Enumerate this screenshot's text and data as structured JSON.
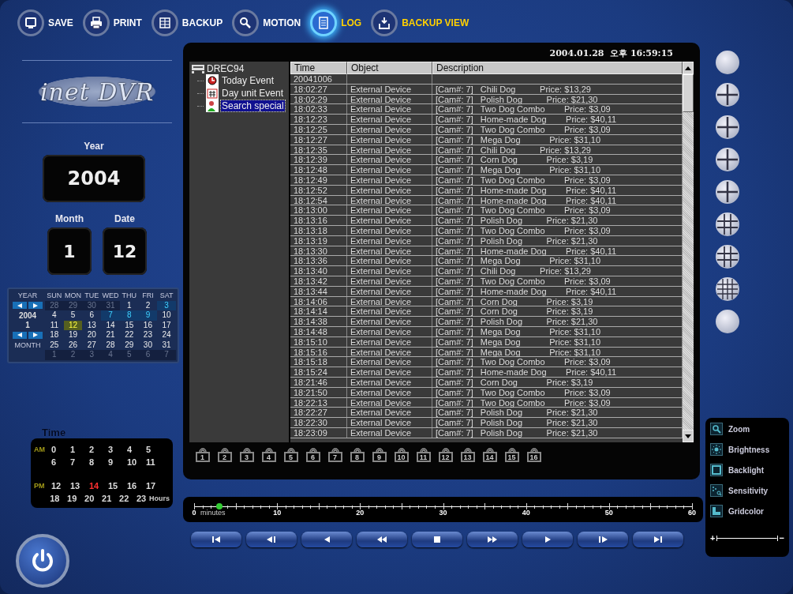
{
  "toolbar": [
    {
      "label": "SAVE",
      "kind": "save",
      "selected": false,
      "highlighted": false
    },
    {
      "label": "PRINT",
      "kind": "print",
      "selected": false,
      "highlighted": false
    },
    {
      "label": "BACKUP",
      "kind": "backup",
      "selected": false,
      "highlighted": false
    },
    {
      "label": "MOTION",
      "kind": "motion",
      "selected": false,
      "highlighted": false
    },
    {
      "label": "LOG",
      "kind": "log",
      "selected": true,
      "highlighted": true
    },
    {
      "label": "BACKUP VIEW",
      "kind": "backup_view",
      "selected": false,
      "highlighted": true
    }
  ],
  "logo": "inet DVR",
  "date_fields": {
    "year_label": "Year",
    "year": "2004",
    "month_label": "Month",
    "month": "1",
    "date_label": "Date",
    "date": "12"
  },
  "calendar": {
    "year_label": "YEAR",
    "year": "2004",
    "month": "1",
    "month_label": "MONTH",
    "weekdays": [
      "SUN",
      "MON",
      "TUE",
      "WED",
      "THU",
      "FRI",
      "SAT"
    ],
    "weeks": [
      [
        {
          "day": "28",
          "current": false,
          "event": false,
          "selected": false
        },
        {
          "day": "29",
          "current": false,
          "event": false,
          "selected": false
        },
        {
          "day": "30",
          "current": false,
          "event": false,
          "selected": false
        },
        {
          "day": "31",
          "current": false,
          "event": false,
          "selected": false
        },
        {
          "day": "1",
          "current": true,
          "event": false,
          "selected": false
        },
        {
          "day": "2",
          "current": true,
          "event": false,
          "selected": false
        },
        {
          "day": "3",
          "current": true,
          "event": true,
          "selected": false
        }
      ],
      [
        {
          "day": "4",
          "current": true,
          "event": false,
          "selected": false
        },
        {
          "day": "5",
          "current": true,
          "event": false,
          "selected": false
        },
        {
          "day": "6",
          "current": true,
          "event": false,
          "selected": false
        },
        {
          "day": "7",
          "current": true,
          "event": true,
          "selected": false
        },
        {
          "day": "8",
          "current": true,
          "event": true,
          "selected": false
        },
        {
          "day": "9",
          "current": true,
          "event": true,
          "selected": false
        },
        {
          "day": "10",
          "current": true,
          "event": false,
          "selected": false
        }
      ],
      [
        {
          "day": "11",
          "current": true,
          "event": false,
          "selected": false
        },
        {
          "day": "12",
          "current": true,
          "event": false,
          "selected": true
        },
        {
          "day": "13",
          "current": true,
          "event": false,
          "selected": false
        },
        {
          "day": "14",
          "current": true,
          "event": false,
          "selected": false
        },
        {
          "day": "15",
          "current": true,
          "event": false,
          "selected": false
        },
        {
          "day": "16",
          "current": true,
          "event": false,
          "selected": false
        },
        {
          "day": "17",
          "current": true,
          "event": false,
          "selected": false
        }
      ],
      [
        {
          "day": "18",
          "current": true,
          "event": false,
          "selected": false
        },
        {
          "day": "19",
          "current": true,
          "event": false,
          "selected": false
        },
        {
          "day": "20",
          "current": true,
          "event": false,
          "selected": false
        },
        {
          "day": "21",
          "current": true,
          "event": false,
          "selected": false
        },
        {
          "day": "22",
          "current": true,
          "event": false,
          "selected": false
        },
        {
          "day": "23",
          "current": true,
          "event": false,
          "selected": false
        },
        {
          "day": "24",
          "current": true,
          "event": false,
          "selected": false
        }
      ],
      [
        {
          "day": "25",
          "current": true,
          "event": false,
          "selected": false
        },
        {
          "day": "26",
          "current": true,
          "event": false,
          "selected": false
        },
        {
          "day": "27",
          "current": true,
          "event": false,
          "selected": false
        },
        {
          "day": "28",
          "current": true,
          "event": false,
          "selected": false
        },
        {
          "day": "29",
          "current": true,
          "event": false,
          "selected": false
        },
        {
          "day": "30",
          "current": true,
          "event": false,
          "selected": false
        },
        {
          "day": "31",
          "current": true,
          "event": false,
          "selected": false
        }
      ],
      [
        {
          "day": "1",
          "current": false,
          "event": false,
          "selected": false
        },
        {
          "day": "2",
          "current": false,
          "event": false,
          "selected": false
        },
        {
          "day": "3",
          "current": false,
          "event": false,
          "selected": false
        },
        {
          "day": "4",
          "current": false,
          "event": false,
          "selected": false
        },
        {
          "day": "5",
          "current": false,
          "event": false,
          "selected": false
        },
        {
          "day": "6",
          "current": false,
          "event": false,
          "selected": false
        },
        {
          "day": "7",
          "current": false,
          "event": false,
          "selected": false
        }
      ]
    ]
  },
  "time": {
    "title": "Time",
    "unit": "Hours",
    "periods": [
      {
        "label": "AM",
        "rows": [
          [
            {
              "hour": "0",
              "selected": false
            },
            {
              "hour": "1",
              "selected": false
            },
            {
              "hour": "2",
              "selected": false
            },
            {
              "hour": "3",
              "selected": false
            },
            {
              "hour": "4",
              "selected": false
            },
            {
              "hour": "5",
              "selected": false
            }
          ],
          [
            {
              "hour": "6",
              "selected": false
            },
            {
              "hour": "7",
              "selected": false
            },
            {
              "hour": "8",
              "selected": false
            },
            {
              "hour": "9",
              "selected": false
            },
            {
              "hour": "10",
              "selected": false
            },
            {
              "hour": "11",
              "selected": false
            }
          ]
        ]
      },
      {
        "label": "PM",
        "rows": [
          [
            {
              "hour": "12",
              "selected": false
            },
            {
              "hour": "13",
              "selected": false
            },
            {
              "hour": "14",
              "selected": true
            },
            {
              "hour": "15",
              "selected": false
            },
            {
              "hour": "16",
              "selected": false
            },
            {
              "hour": "17",
              "selected": false
            }
          ],
          [
            {
              "hour": "18",
              "selected": false
            },
            {
              "hour": "19",
              "selected": false
            },
            {
              "hour": "20",
              "selected": false
            },
            {
              "hour": "21",
              "selected": false
            },
            {
              "hour": "22",
              "selected": false
            },
            {
              "hour": "23",
              "selected": false
            }
          ]
        ]
      }
    ]
  },
  "datetime": "2004.01.28  오후 16:59:15",
  "tree": {
    "label": "DREC94",
    "children": [
      {
        "label": "Today Event",
        "kind": "today",
        "selected": false
      },
      {
        "label": "Day unit Event",
        "kind": "day",
        "selected": false
      },
      {
        "label": "Search special",
        "kind": "search",
        "selected": true
      }
    ]
  },
  "table": {
    "columns": [
      "Time",
      "Object",
      "Description"
    ],
    "date_row": "20041006",
    "rows": [
      {
        "time": "18:02:27",
        "object": "External Device",
        "description": "[Cam#: 7]   Chili Dog          Price: $13,29"
      },
      {
        "time": "18:02:29",
        "object": "External Device",
        "description": "[Cam#: 7]   Polish Dog          Price: $21,30"
      },
      {
        "time": "18:02:33",
        "object": "External Device",
        "description": "[Cam#: 7]   Two Dog Combo        Price: $3,09"
      },
      {
        "time": "18:12:23",
        "object": "External Device",
        "description": "[Cam#: 7]   Home-made Dog        Price: $40,11"
      },
      {
        "time": "18:12:25",
        "object": "External Device",
        "description": "[Cam#: 7]   Two Dog Combo        Price: $3,09"
      },
      {
        "time": "18:12:27",
        "object": "External Device",
        "description": "[Cam#: 7]   Mega Dog            Price: $31,10"
      },
      {
        "time": "18:12:35",
        "object": "External Device",
        "description": "[Cam#: 7]   Chili Dog          Price: $13,29"
      },
      {
        "time": "18:12:39",
        "object": "External Device",
        "description": "[Cam#: 7]   Corn Dog            Price: $3,19"
      },
      {
        "time": "18:12:48",
        "object": "External Device",
        "description": "[Cam#: 7]   Mega Dog            Price: $31,10"
      },
      {
        "time": "18:12:49",
        "object": "External Device",
        "description": "[Cam#: 7]   Two Dog Combo        Price: $3,09"
      },
      {
        "time": "18:12:52",
        "object": "External Device",
        "description": "[Cam#: 7]   Home-made Dog        Price: $40,11"
      },
      {
        "time": "18:12:54",
        "object": "External Device",
        "description": "[Cam#: 7]   Home-made Dog        Price: $40,11"
      },
      {
        "time": "18:13:00",
        "object": "External Device",
        "description": "[Cam#: 7]   Two Dog Combo        Price: $3,09"
      },
      {
        "time": "18:13:16",
        "object": "External Device",
        "description": "[Cam#: 7]   Polish Dog          Price: $21,30"
      },
      {
        "time": "18:13:18",
        "object": "External Device",
        "description": "[Cam#: 7]   Two Dog Combo        Price: $3,09"
      },
      {
        "time": "18:13:19",
        "object": "External Device",
        "description": "[Cam#: 7]   Polish Dog          Price: $21,30"
      },
      {
        "time": "18:13:30",
        "object": "External Device",
        "description": "[Cam#: 7]   Home-made Dog        Price: $40,11"
      },
      {
        "time": "18:13:36",
        "object": "External Device",
        "description": "[Cam#: 7]   Mega Dog            Price: $31,10"
      },
      {
        "time": "18:13:40",
        "object": "External Device",
        "description": "[Cam#: 7]   Chili Dog          Price: $13,29"
      },
      {
        "time": "18:13:42",
        "object": "External Device",
        "description": "[Cam#: 7]   Two Dog Combo        Price: $3,09"
      },
      {
        "time": "18:13:44",
        "object": "External Device",
        "description": "[Cam#: 7]   Home-made Dog        Price: $40,11"
      },
      {
        "time": "18:14:06",
        "object": "External Device",
        "description": "[Cam#: 7]   Corn Dog            Price: $3,19"
      },
      {
        "time": "18:14:14",
        "object": "External Device",
        "description": "[Cam#: 7]   Corn Dog            Price: $3,19"
      },
      {
        "time": "18:14:38",
        "object": "External Device",
        "description": "[Cam#: 7]   Polish Dog          Price: $21,30"
      },
      {
        "time": "18:14:48",
        "object": "External Device",
        "description": "[Cam#: 7]   Mega Dog            Price: $31,10"
      },
      {
        "time": "18:15:10",
        "object": "External Device",
        "description": "[Cam#: 7]   Mega Dog            Price: $31,10"
      },
      {
        "time": "18:15:16",
        "object": "External Device",
        "description": "[Cam#: 7]   Mega Dog            Price: $31,10"
      },
      {
        "time": "18:15:18",
        "object": "External Device",
        "description": "[Cam#: 7]   Two Dog Combo        Price: $3,09"
      },
      {
        "time": "18:15:24",
        "object": "External Device",
        "description": "[Cam#: 7]   Home-made Dog        Price: $40,11"
      },
      {
        "time": "18:21:46",
        "object": "External Device",
        "description": "[Cam#: 7]   Corn Dog            Price: $3,19"
      },
      {
        "time": "18:21:50",
        "object": "External Device",
        "description": "[Cam#: 7]   Two Dog Combo        Price: $3,09"
      },
      {
        "time": "18:22:13",
        "object": "External Device",
        "description": "[Cam#: 7]   Two Dog Combo        Price: $3,09"
      },
      {
        "time": "18:22:27",
        "object": "External Device",
        "description": "[Cam#: 7]   Polish Dog          Price: $21,30"
      },
      {
        "time": "18:22:30",
        "object": "External Device",
        "description": "[Cam#: 7]   Polish Dog          Price: $21,30"
      },
      {
        "time": "18:23:09",
        "object": "External Device",
        "description": "[Cam#: 7]   Polish Dog          Price: $21,30"
      }
    ]
  },
  "cameras": [
    "1",
    "2",
    "3",
    "4",
    "5",
    "6",
    "7",
    "8",
    "9",
    "10",
    "11",
    "12",
    "13",
    "14",
    "15",
    "16"
  ],
  "timeline": {
    "labels": [
      "0",
      "10",
      "20",
      "30",
      "40",
      "50",
      "60"
    ],
    "unit": "minutes",
    "level": 0.05
  },
  "playback": [
    {
      "kind": "first"
    },
    {
      "kind": "step_back"
    },
    {
      "kind": "reverse"
    },
    {
      "kind": "rewind"
    },
    {
      "kind": "stop"
    },
    {
      "kind": "fast_forward"
    },
    {
      "kind": "play"
    },
    {
      "kind": "step_forward"
    },
    {
      "kind": "last"
    }
  ],
  "view_buttons": [
    {
      "kind": "single"
    },
    {
      "kind": "quad"
    },
    {
      "kind": "quad"
    },
    {
      "kind": "quad"
    },
    {
      "kind": "quad"
    },
    {
      "kind": "nine"
    },
    {
      "kind": "nine"
    },
    {
      "kind": "sixteen"
    },
    {
      "kind": "single"
    }
  ],
  "adjustments": [
    {
      "label": "Zoom",
      "kind": "zoom"
    },
    {
      "label": "Brightness",
      "kind": "brightness"
    },
    {
      "label": "Backlight",
      "kind": "backlight"
    },
    {
      "label": "Sensitivity",
      "kind": "sensitivity"
    },
    {
      "label": "Gridcolor",
      "kind": "gridcolor"
    }
  ],
  "slider": {
    "plus": "+",
    "minus": "−"
  }
}
